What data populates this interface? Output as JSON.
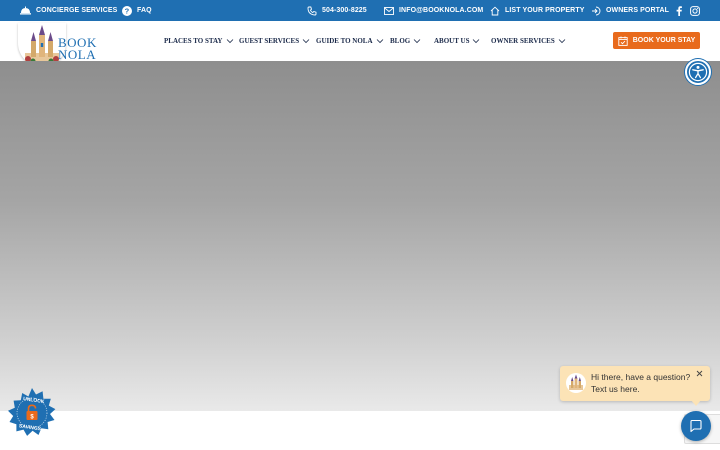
{
  "topbar": {
    "concierge": "Concierge Services",
    "faq": "FAQ",
    "phone": "504-300-8225",
    "email": "info@booknola.com",
    "list_property": "List Your Property",
    "owners_portal": "Owners Portal"
  },
  "logo": {
    "line1": "BOOK",
    "line2": "NOLA"
  },
  "nav": {
    "items": [
      {
        "label": "Places to Stay"
      },
      {
        "label": "Guest Services"
      },
      {
        "label": "Guide to NOLA"
      },
      {
        "label": "Blog"
      },
      {
        "label": "About Us"
      },
      {
        "label": "Owner Services"
      }
    ]
  },
  "cta": {
    "book": "Book Your Stay"
  },
  "savings": {
    "top": "UNLOCK",
    "bottom": "SAVINGS"
  },
  "chat": {
    "line1": "Hi there, have a question?",
    "line2": "Text us here."
  },
  "colors": {
    "brand_blue": "#1f6fb2",
    "accent_orange": "#e86a1c",
    "chat_bg": "#fce3b6"
  }
}
